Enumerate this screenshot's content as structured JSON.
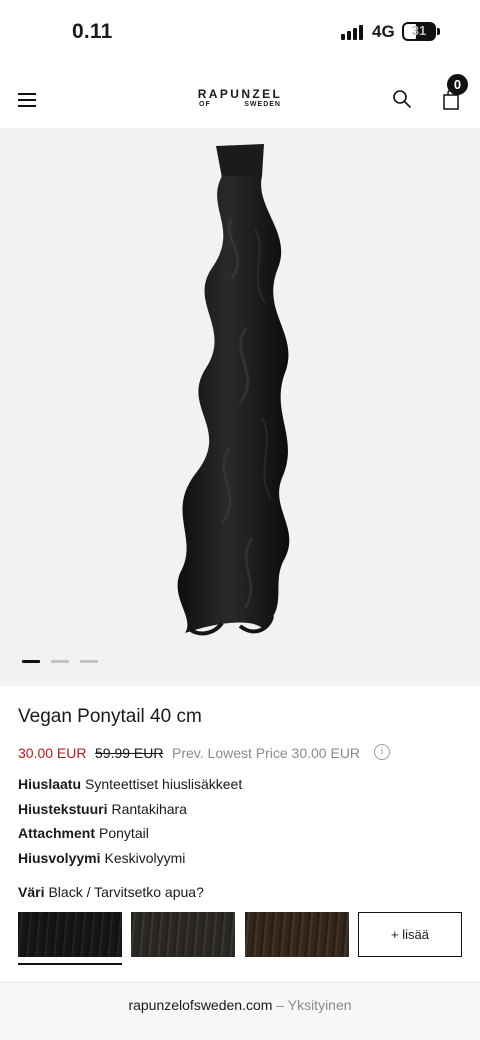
{
  "status_bar": {
    "time": "0.11",
    "network": "4G",
    "battery": "31"
  },
  "header": {
    "logo_main": "RAPUNZEL",
    "logo_of": "OF",
    "logo_sweden": "SWEDEN",
    "cart_count": "0",
    "icons": [
      "menu-icon",
      "search-icon",
      "cart-icon"
    ]
  },
  "gallery": {
    "slide_count": 3,
    "active_slide": 1
  },
  "product": {
    "title": "Vegan Ponytail 40 cm",
    "price_sale": "30.00 EUR",
    "price_old": "59.99 EUR",
    "price_prev_lowest": "Prev. Lowest Price 30.00 EUR",
    "specs": [
      {
        "label": "Hiuslaatu",
        "value": "Synteettiset hiuslisäkkeet"
      },
      {
        "label": "Hiustekstuuri",
        "value": "Rantakihara"
      },
      {
        "label": "Attachment",
        "value": "Ponytail"
      },
      {
        "label": "Hiusvolyymi",
        "value": "Keskivolyymi"
      }
    ],
    "color_label": "Väri",
    "color_value": "Black / Tarvitsetko apua?",
    "swatches": [
      {
        "name": "black",
        "color": "#161616",
        "selected": true
      },
      {
        "name": "dark-brown",
        "color": "#2b2823",
        "selected": false
      },
      {
        "name": "brown",
        "color": "#34271d",
        "selected": false
      }
    ],
    "more_label": "+ lisää"
  },
  "browser": {
    "url": "rapunzelofsweden.com",
    "mode": " – Yksityinen"
  },
  "colors": {
    "sale_red": "#b31b1b",
    "muted_gray": "#8a8a8a",
    "image_bg": "#f2f2f2"
  }
}
